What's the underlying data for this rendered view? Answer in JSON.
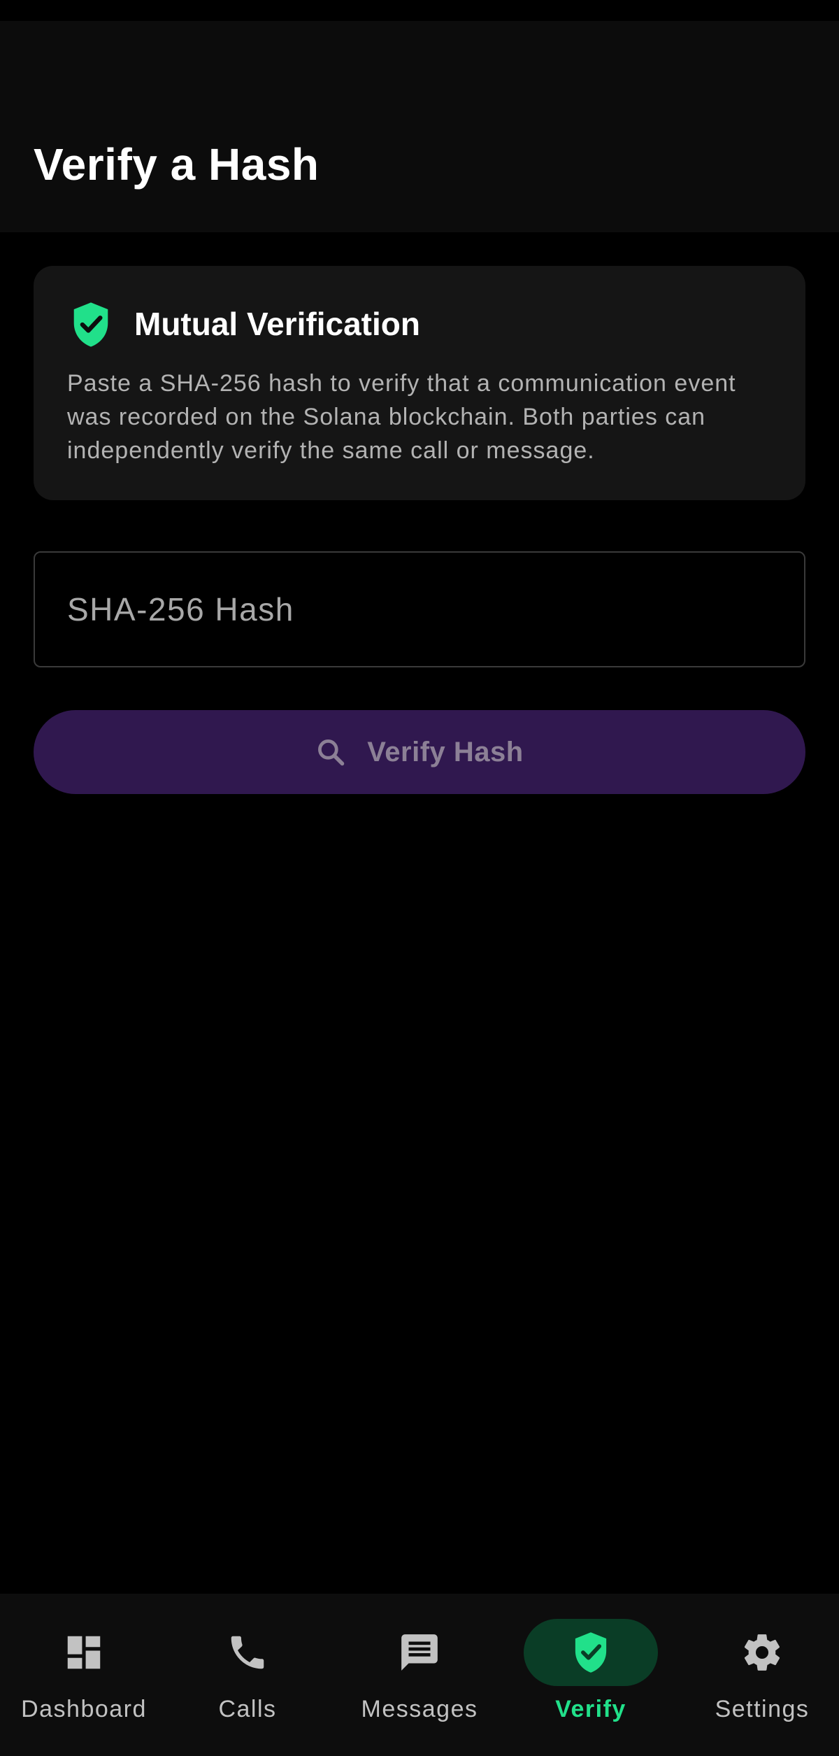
{
  "header": {
    "title": "Verify a Hash"
  },
  "info_card": {
    "title": "Mutual Verification",
    "body": "Paste a SHA-256 hash to verify that a communication event was recorded on the Solana blockchain. Both parties can independently verify the same call or message.",
    "icon": "shield-check-icon"
  },
  "hash_input": {
    "placeholder": "SHA-256 Hash",
    "value": ""
  },
  "verify_button": {
    "label": "Verify Hash",
    "icon": "search-icon"
  },
  "nav": {
    "items": [
      {
        "label": "Dashboard",
        "icon": "dashboard-icon",
        "active": false
      },
      {
        "label": "Calls",
        "icon": "phone-icon",
        "active": false
      },
      {
        "label": "Messages",
        "icon": "message-icon",
        "active": false
      },
      {
        "label": "Verify",
        "icon": "shield-check-icon",
        "active": true
      },
      {
        "label": "Settings",
        "icon": "gear-icon",
        "active": false
      }
    ]
  },
  "colors": {
    "accent": "#21e08a",
    "button_bg": "#30184f",
    "card_bg": "#151515"
  }
}
